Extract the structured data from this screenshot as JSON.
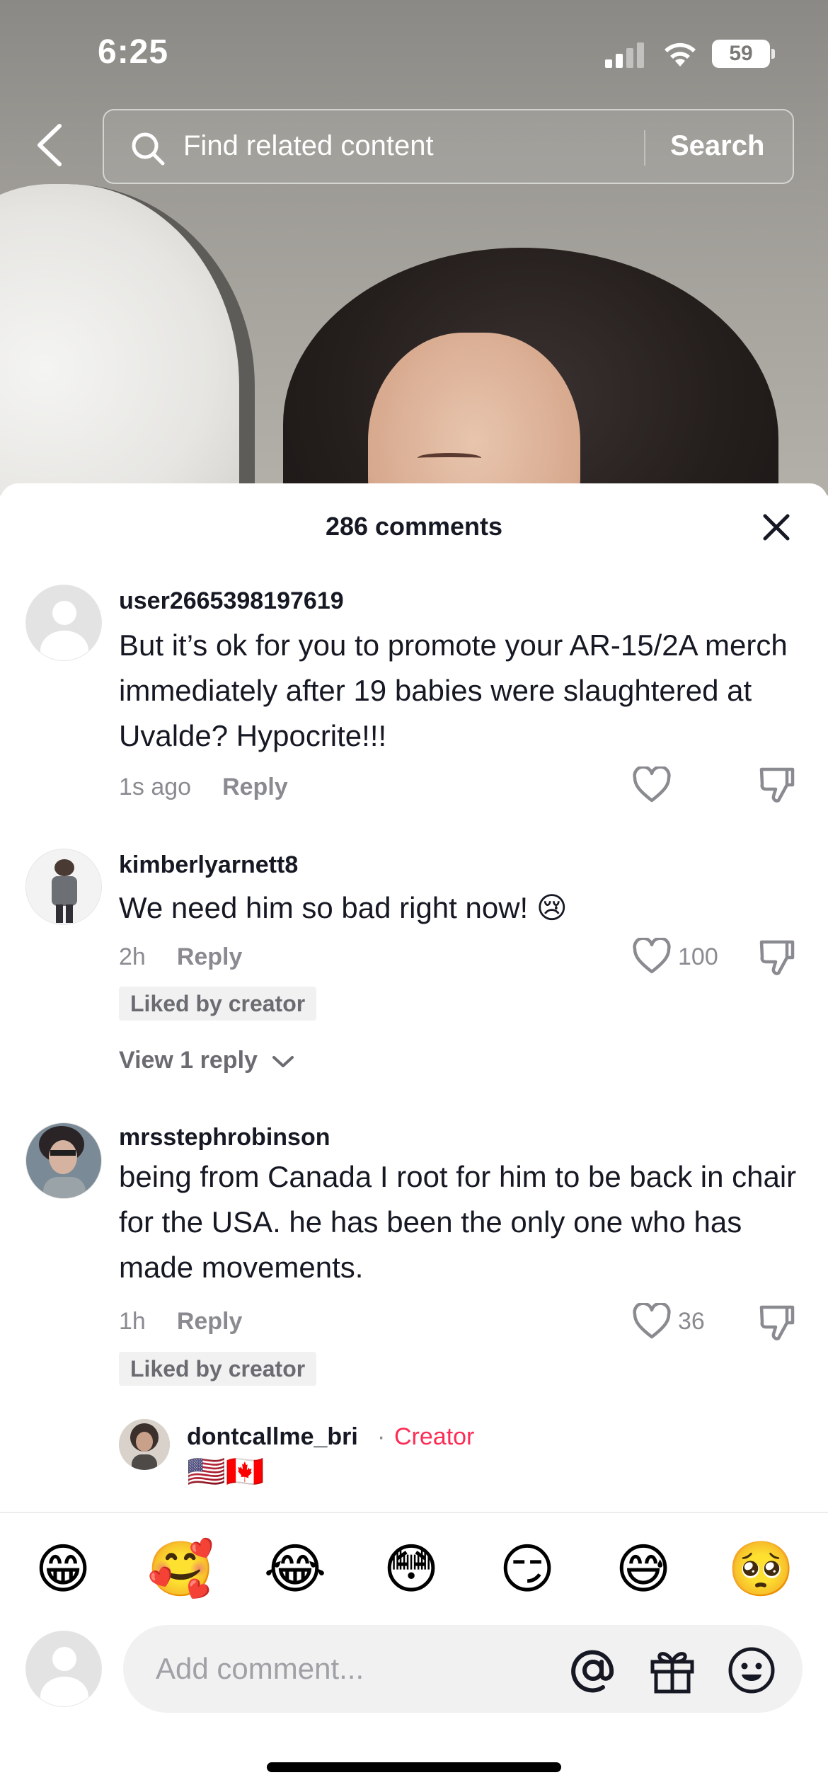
{
  "status_bar": {
    "time": "6:25",
    "battery": "59"
  },
  "top_bar": {
    "search_placeholder": "Find related content",
    "search_button": "Search"
  },
  "sheet": {
    "title": "286 comments"
  },
  "comments": [
    {
      "username": "user2665398197619",
      "text": "But it’s ok for you to promote your AR-15/2A merch immediately after 19 babies were slaughtered at Uvalde? Hypocrite!!!",
      "time": "1s ago",
      "reply_label": "Reply",
      "likes": ""
    },
    {
      "username": "kimberlyarnett8",
      "text": "We need him so bad right now! 😢",
      "time": "2h",
      "reply_label": "Reply",
      "likes": "100",
      "badge": "Liked by creator",
      "view_replies": "View 1 reply"
    },
    {
      "username": "mrsstephrobinson",
      "text": "being from Canada I root for him to be back in chair for the USA. he has been the only one who has made movements.",
      "time": "1h",
      "reply_label": "Reply",
      "likes": "36",
      "badge": "Liked by creator",
      "reply": {
        "username": "dontcallme_bri",
        "separator": "·",
        "role": "Creator",
        "text": "🇺🇸🇨🇦"
      }
    }
  ],
  "emoji_bar": [
    "😁",
    "🥰",
    "😂",
    "😳",
    "😏",
    "😅",
    "🥺"
  ],
  "input": {
    "placeholder": "Add comment..."
  },
  "colors": {
    "accent": "#fe2c55",
    "text": "#161823",
    "muted": "#8a8b91"
  }
}
